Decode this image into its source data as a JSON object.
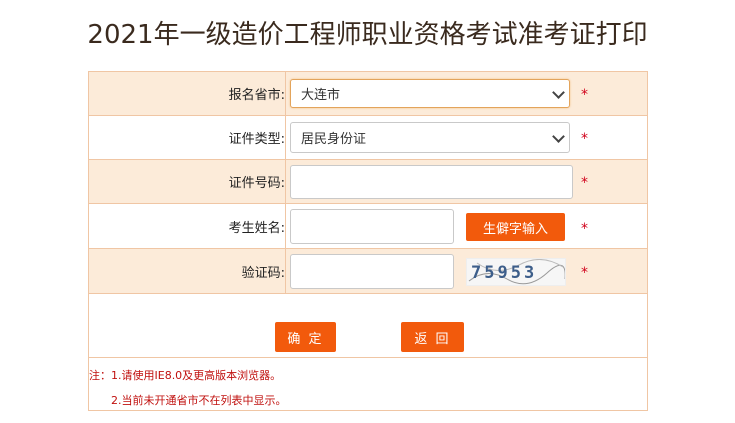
{
  "page_title": "2021年一级造价工程师职业资格考试准考证打印",
  "form": {
    "province": {
      "label": "报名省市:",
      "value": "大连市"
    },
    "id_type": {
      "label": "证件类型:",
      "value": "居民身份证"
    },
    "id_number": {
      "label": "证件号码:",
      "value": ""
    },
    "name": {
      "label": "考生姓名:",
      "value": "",
      "rare_char_button": "生僻字输入"
    },
    "captcha": {
      "label": "验证码:",
      "value": "",
      "image_text": "75953"
    },
    "required_mark": "*"
  },
  "buttons": {
    "confirm": "确 定",
    "back": "返 回"
  },
  "notes": {
    "line1": "注：1.请使用IE8.0及更高版本浏览器。",
    "line2": "2.当前未开通省市不在列表中显示。"
  },
  "colors": {
    "accent": "#f25a0c",
    "row_shade": "#fcebd9",
    "border": "#f0c6a4",
    "required": "#d0021b"
  }
}
